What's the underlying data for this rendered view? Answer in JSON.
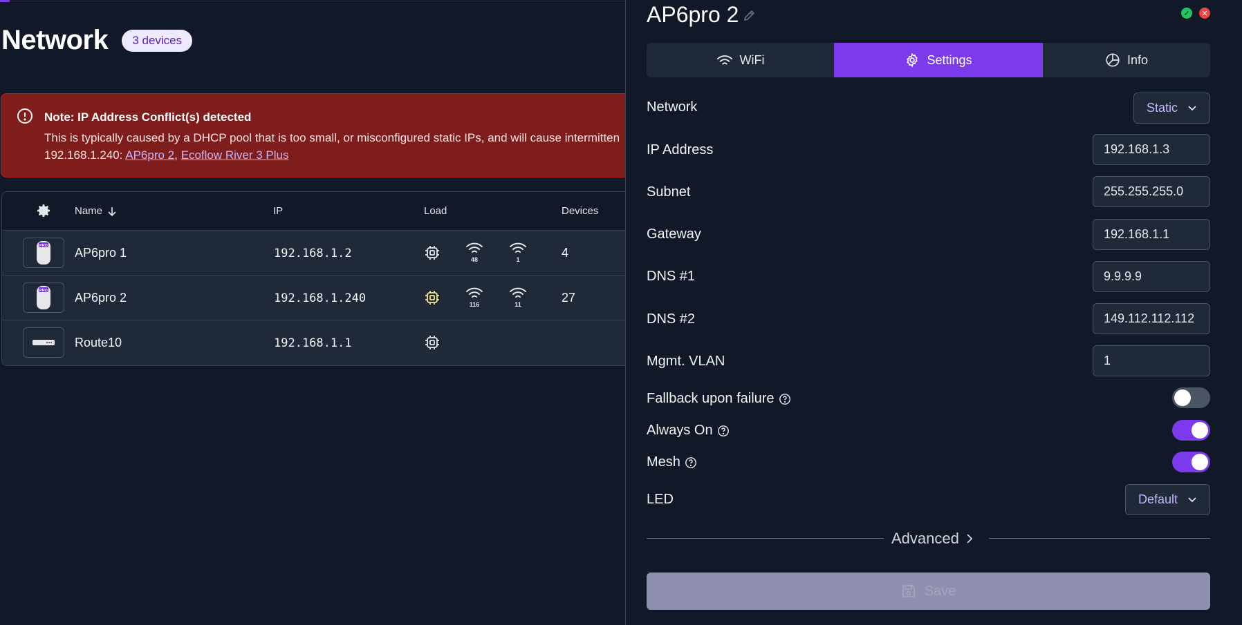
{
  "network": {
    "title": "Network",
    "device_count": "3 devices"
  },
  "alert": {
    "title": "Note: IP Address Conflict(s) detected",
    "body": "This is typically caused by a DHCP pool that is too small, or misconfigured static IPs, and will cause intermitten",
    "conflict_ip": "192.168.1.240:",
    "separator": ",",
    "conflict_devices": [
      "AP6pro 2",
      "Ecoflow River 3 Plus"
    ]
  },
  "table": {
    "headers": {
      "name": "Name",
      "ip": "IP",
      "load": "Load",
      "devices": "Devices"
    },
    "rows": [
      {
        "name": "AP6pro 1",
        "ip": "192.168.1.2",
        "icon": "ap-pro-icon",
        "wifi_a": "48",
        "wifi_b": "1",
        "devices": "4"
      },
      {
        "name": "AP6pro 2",
        "ip": "192.168.1.240",
        "icon": "ap-pro-icon",
        "wifi_a": "116",
        "wifi_b": "11",
        "devices": "27"
      },
      {
        "name": "Route10",
        "ip": "192.168.1.1",
        "icon": "router-icon",
        "wifi_a": "",
        "wifi_b": "",
        "devices": ""
      }
    ]
  },
  "panel": {
    "title": "AP6pro 2",
    "tabs": [
      {
        "label": "WiFi",
        "icon": "wifi-icon"
      },
      {
        "label": "Settings",
        "icon": "gear-icon"
      },
      {
        "label": "Info",
        "icon": "info-icon"
      }
    ],
    "active_tab": "Settings",
    "fields": {
      "network_label": "Network",
      "network_mode": "Static",
      "ip_label": "IP Address",
      "ip_value": "192.168.1.3",
      "subnet_label": "Subnet",
      "subnet_value": "255.255.255.0",
      "gateway_label": "Gateway",
      "gateway_value": "192.168.1.1",
      "dns1_label": "DNS #1",
      "dns1_value": "9.9.9.9",
      "dns2_label": "DNS #2",
      "dns2_value": "149.112.112.112",
      "vlan_label": "Mgmt. VLAN",
      "vlan_value": "1",
      "fallback_label": "Fallback upon failure",
      "fallback_on": false,
      "always_on_label": "Always On",
      "always_on": true,
      "mesh_label": "Mesh",
      "mesh_on": true,
      "led_label": "LED",
      "led_value": "Default"
    },
    "advanced_label": "Advanced",
    "save_label": "Save"
  },
  "colors": {
    "accent": "#7c3aed",
    "alert_bg": "#7f1d1d",
    "background": "#111827",
    "row_bg": "#1f2937",
    "close_red": "#ef4444",
    "ok_green": "#22c55e"
  }
}
